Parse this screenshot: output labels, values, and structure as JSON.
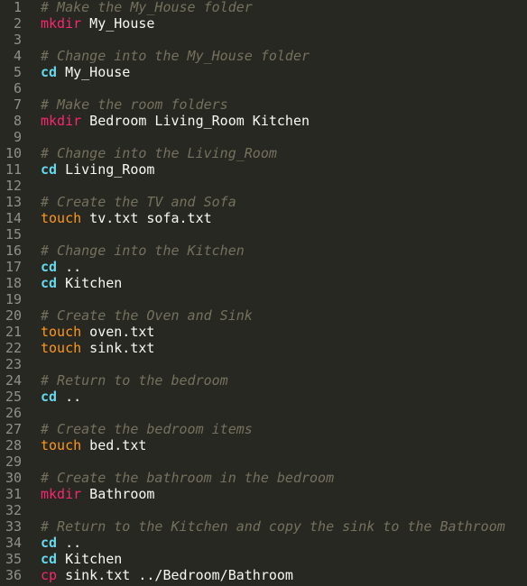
{
  "editor": {
    "lines": [
      {
        "n": "1",
        "comment": "# Make the My_House folder"
      },
      {
        "n": "2",
        "cmd": "mkdir",
        "args": " My_House"
      },
      {
        "n": "3"
      },
      {
        "n": "4",
        "comment": "# Change into the My_House folder"
      },
      {
        "n": "5",
        "cmd": "cd",
        "args": " My_House"
      },
      {
        "n": "6"
      },
      {
        "n": "7",
        "comment": "# Make the room folders"
      },
      {
        "n": "8",
        "cmd": "mkdir",
        "args": " Bedroom Living_Room Kitchen"
      },
      {
        "n": "9"
      },
      {
        "n": "10",
        "comment": "# Change into the Living_Room"
      },
      {
        "n": "11",
        "cmd": "cd",
        "args": " Living_Room"
      },
      {
        "n": "12"
      },
      {
        "n": "13",
        "comment": "# Create the TV and Sofa"
      },
      {
        "n": "14",
        "cmd": "touch",
        "args": " tv.txt sofa.txt"
      },
      {
        "n": "15"
      },
      {
        "n": "16",
        "comment": "# Change into the Kitchen"
      },
      {
        "n": "17",
        "cmd": "cd",
        "args": " .."
      },
      {
        "n": "18",
        "cmd": "cd",
        "args": " Kitchen"
      },
      {
        "n": "19"
      },
      {
        "n": "20",
        "comment": "# Create the Oven and Sink"
      },
      {
        "n": "21",
        "cmd": "touch",
        "args": " oven.txt"
      },
      {
        "n": "22",
        "cmd": "touch",
        "args": " sink.txt"
      },
      {
        "n": "23"
      },
      {
        "n": "24",
        "comment": "# Return to the bedroom"
      },
      {
        "n": "25",
        "cmd": "cd",
        "args": " .."
      },
      {
        "n": "26"
      },
      {
        "n": "27",
        "comment": "# Create the bedroom items"
      },
      {
        "n": "28",
        "cmd": "touch",
        "args": " bed.txt"
      },
      {
        "n": "29"
      },
      {
        "n": "30",
        "comment": "# Create the bathroom in the bedroom"
      },
      {
        "n": "31",
        "cmd": "mkdir",
        "args": " Bathroom"
      },
      {
        "n": "32"
      },
      {
        "n": "33",
        "comment": "# Return to the Kitchen and copy the sink to the Bathroom"
      },
      {
        "n": "34",
        "cmd": "cd",
        "args": " .."
      },
      {
        "n": "35",
        "cmd": "cd",
        "args": " Kitchen"
      },
      {
        "n": "36",
        "cmd": "cp",
        "args": " sink.txt ../Bedroom/Bathroom"
      }
    ]
  },
  "colors": {
    "background": "#272822",
    "line_number": "#8f908a",
    "comment": "#75715e",
    "mkdir": "#f92672",
    "touch": "#fd971f",
    "cd": "#66d9ef",
    "cp": "#f92672",
    "text": "#f8f8f2"
  }
}
